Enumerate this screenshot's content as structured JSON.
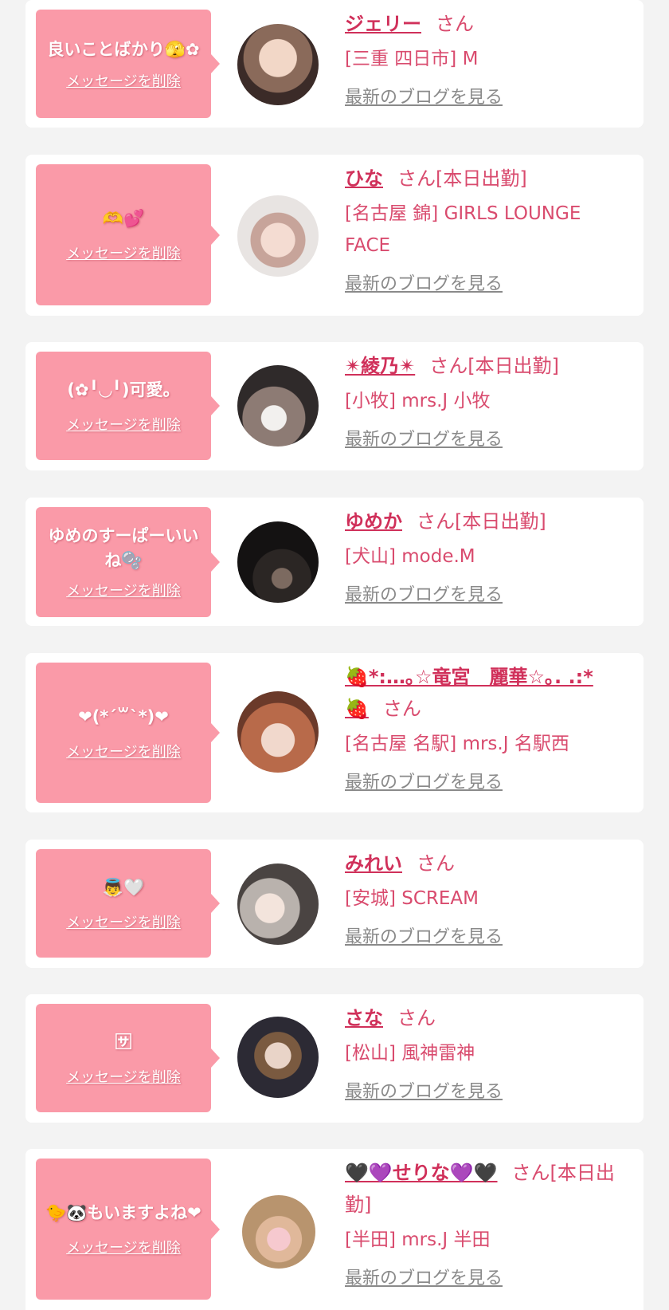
{
  "colors": {
    "background": "#f3f3f3",
    "card": "#ffffff",
    "bubble": "#fa9aa8",
    "name": "#d0305a",
    "text_pink": "#d94b6e",
    "link_gray": "#8a8a8a"
  },
  "items": [
    {
      "message": "良いことばかり🫣✿",
      "delete_label": "メッセージを削除",
      "name": "ジェリー",
      "suffix": "さん",
      "shop": "[三重 四日市] M",
      "blog_link": "最新のブログを見る",
      "avatar_icon": "avatar-photo"
    },
    {
      "message": "🫶💕",
      "delete_label": "メッセージを削除",
      "name": "ひな",
      "suffix": "さん[本日出勤]",
      "shop": "[名古屋 錦] GIRLS LOUNGE FACE",
      "blog_link": "最新のブログを見る",
      "avatar_icon": "avatar-photo"
    },
    {
      "message": "(✿╹◡╹)可愛。",
      "delete_label": "メッセージを削除",
      "name": "✴綾乃✴",
      "suffix": "さん[本日出勤]",
      "shop": "[小牧] mrs.J 小牧",
      "blog_link": "最新のブログを見る",
      "avatar_icon": "avatar-photo"
    },
    {
      "message": "ゆめのすーぱーいいね🫧",
      "delete_label": "メッセージを削除",
      "name": "ゆめか",
      "suffix": "さん[本日出勤]",
      "shop": "[犬山] mode.M",
      "blog_link": "最新のブログを見る",
      "avatar_icon": "avatar-photo"
    },
    {
      "message": "❤(*´꒳`*)❤",
      "delete_label": "メッセージを削除",
      "name": "🍓*:…｡☆竜宮　麗華☆｡. .:*🍓",
      "suffix": "さん",
      "shop": "[名古屋 名駅] mrs.J 名駅西",
      "blog_link": "最新のブログを見る",
      "avatar_icon": "avatar-photo"
    },
    {
      "message": "👼🤍",
      "delete_label": "メッセージを削除",
      "name": "みれい",
      "suffix": "さん",
      "shop": "[安城] SCREAM",
      "blog_link": "最新のブログを見る",
      "avatar_icon": "avatar-photo"
    },
    {
      "message": "🈂",
      "delete_label": "メッセージを削除",
      "name": "さな",
      "suffix": "さん",
      "shop": "[松山] 風神雷神",
      "blog_link": "最新のブログを見る",
      "avatar_icon": "avatar-photo"
    },
    {
      "message": "🐤🐼もいますよね❤",
      "delete_label": "メッセージを削除",
      "name": "🖤💜せりな💜🖤",
      "suffix": "さん[本日出勤]",
      "shop": "[半田] mrs.J 半田",
      "blog_link": "最新のブログを見る",
      "avatar_icon": "avatar-photo"
    }
  ]
}
